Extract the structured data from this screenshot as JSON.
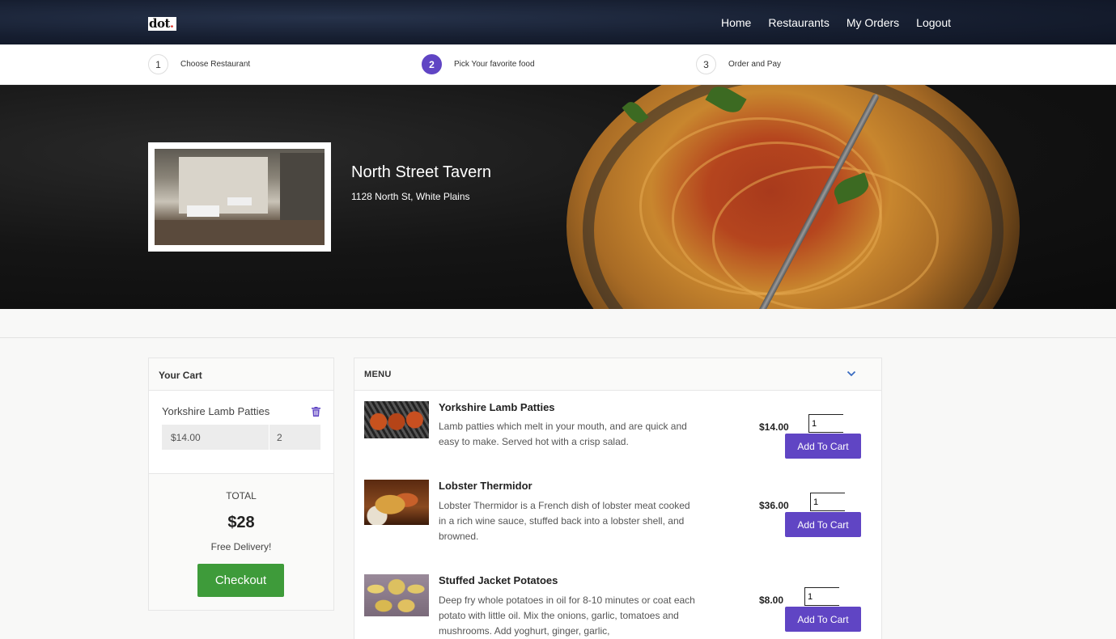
{
  "nav": {
    "logo_text": "dot",
    "logo_dot": ".",
    "links": [
      "Home",
      "Restaurants",
      "My Orders",
      "Logout"
    ]
  },
  "steps": [
    {
      "num": "1",
      "label": "Choose Restaurant",
      "active": false
    },
    {
      "num": "2",
      "label": "Pick Your favorite food",
      "active": true
    },
    {
      "num": "3",
      "label": "Order and Pay",
      "active": false
    }
  ],
  "restaurant": {
    "name": "North Street Tavern",
    "address": "1128 North St, White Plains"
  },
  "cart": {
    "title": "Your Cart",
    "items": [
      {
        "name": "Yorkshire Lamb Patties",
        "price": "$14.00",
        "qty": "2"
      }
    ],
    "total_label": "TOTAL",
    "total_value": "$28",
    "delivery_text": "Free Delivery!",
    "checkout_label": "Checkout",
    "delete_icon": "trash-icon"
  },
  "menu": {
    "title": "MENU",
    "toggle_icon": "chevron-down-icon",
    "items": [
      {
        "name": "Yorkshire Lamb Patties",
        "description": "Lamb patties which melt in your mouth, and are quick and easy to make. Served hot with a crisp salad.",
        "price": "$14.00",
        "qty": "1",
        "button": "Add To Cart"
      },
      {
        "name": "Lobster Thermidor",
        "description": "Lobster Thermidor is a French dish of lobster meat cooked in a rich wine sauce, stuffed back into a lobster shell, and browned.",
        "price": "$36.00",
        "qty": "1",
        "button": "Add To Cart"
      },
      {
        "name": "Stuffed Jacket Potatoes",
        "description": "Deep fry whole potatoes in oil for 8-10 minutes or coat each potato with little oil. Mix the onions, garlic, tomatoes and mushrooms. Add yoghurt, ginger, garlic,",
        "price": "$8.00",
        "qty": "1",
        "button": "Add To Cart"
      }
    ]
  },
  "colors": {
    "accent": "#6045c4",
    "checkout": "#3e9b3a",
    "navbar": "#161e30"
  }
}
